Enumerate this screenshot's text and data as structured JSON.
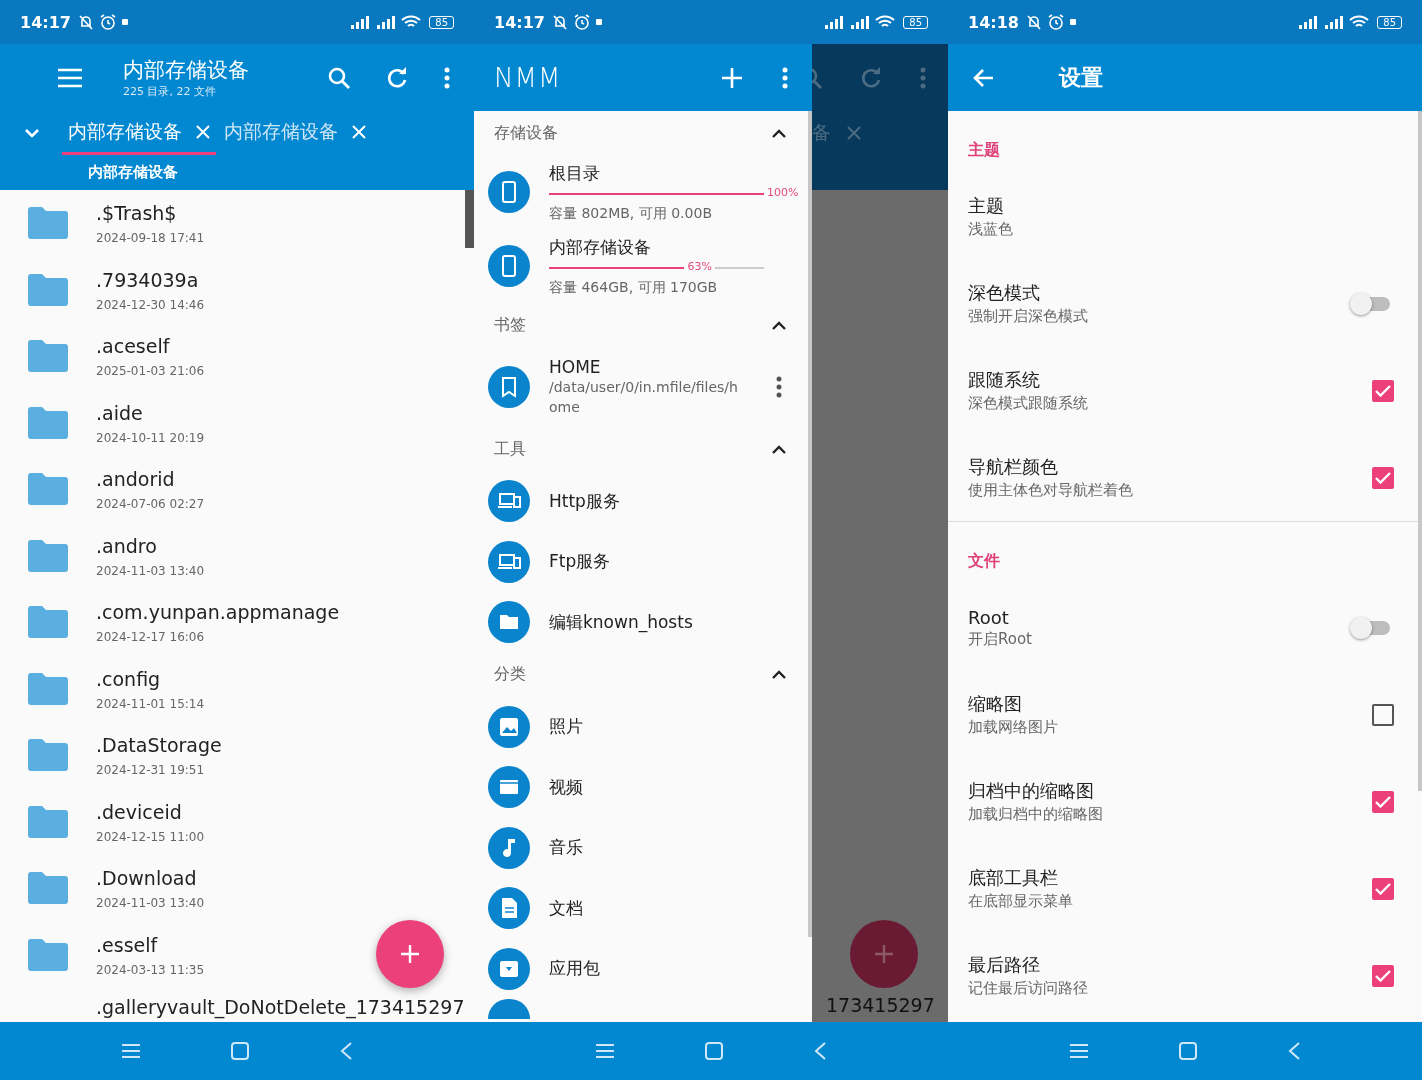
{
  "file_manager": {
    "status_bar": {
      "time": "14:17",
      "battery": "85"
    },
    "title": "内部存储设备",
    "subtitle": "225 目录, 22 文件",
    "tabs": [
      {
        "label": "内部存储设备",
        "selected": true
      },
      {
        "label": "内部存储设备",
        "selected": false
      }
    ],
    "path": "内部存储设备",
    "files": [
      {
        "name": ".$Trash$",
        "date": "2024-09-18 17:41"
      },
      {
        "name": ".7934039a",
        "date": "2024-12-30 14:46"
      },
      {
        "name": ".aceself",
        "date": "2025-01-03 21:06"
      },
      {
        "name": ".aide",
        "date": "2024-10-11 20:19"
      },
      {
        "name": ".andorid",
        "date": "2024-07-06 02:27"
      },
      {
        "name": ".andro",
        "date": "2024-11-03 13:40"
      },
      {
        "name": ".com.yunpan.appmanage",
        "date": "2024-12-17 16:06"
      },
      {
        "name": ".config",
        "date": "2024-11-01 15:14"
      },
      {
        "name": ".DataStorage",
        "date": "2024-12-31 19:51"
      },
      {
        "name": ".deviceid",
        "date": "2024-12-15 11:00"
      },
      {
        "name": ".Download",
        "date": "2024-11-03 13:40"
      },
      {
        "name": ".esself",
        "date": "2024-03-13 11:35"
      },
      {
        "name": ".galleryvault_DoNotDelete_173415297"
      }
    ]
  },
  "drawer_screen": {
    "status_bar": {
      "time": "14:17",
      "battery": "85"
    },
    "title": "NMM",
    "sections": [
      {
        "title": "存储设备",
        "expanded": true,
        "items": [
          {
            "kind": "storage",
            "name": "根目录",
            "level": 1.0,
            "reading": "100%",
            "detail": "容量 802MB, 可用 0.00B"
          },
          {
            "kind": "storage",
            "name": "内部存储设备",
            "level": 0.63,
            "reading": "63%",
            "detail": "容量 464GB, 可用 170GB"
          }
        ]
      },
      {
        "title": "书签",
        "expanded": true,
        "items": [
          {
            "kind": "bookmark",
            "name": "HOME",
            "detail": "/data/user/0/in.mfile/files/home"
          }
        ]
      },
      {
        "title": "工具",
        "expanded": true,
        "items": [
          {
            "kind": "tool",
            "name": "Http服务"
          },
          {
            "kind": "tool",
            "name": "Ftp服务"
          },
          {
            "kind": "folder",
            "name": "编辑known_hosts"
          }
        ]
      },
      {
        "title": "分类",
        "expanded": true,
        "items": [
          {
            "kind": "image",
            "name": "照片"
          },
          {
            "kind": "video",
            "name": "视频"
          },
          {
            "kind": "music",
            "name": "音乐"
          },
          {
            "kind": "document",
            "name": "文档"
          },
          {
            "kind": "package",
            "name": "应用包"
          }
        ]
      }
    ],
    "behind": {
      "tab_fragment": "备",
      "file_fragment": "173415297"
    }
  },
  "settings_screen": {
    "status_bar": {
      "time": "14:18",
      "battery": "85"
    },
    "title": "设置",
    "sections": [
      {
        "title": "主题",
        "items": [
          {
            "kind": "text",
            "title": "主题",
            "summary": "浅蓝色"
          },
          {
            "kind": "switch",
            "title": "深色模式",
            "summary": "强制开启深色模式",
            "checked": false
          },
          {
            "kind": "checkbox",
            "title": "跟随系统",
            "summary": "深色模式跟随系统",
            "checked": true
          },
          {
            "kind": "checkbox",
            "title": "导航栏颜色",
            "summary": "使用主体色对导航栏着色",
            "checked": true
          }
        ]
      },
      {
        "title": "文件",
        "items": [
          {
            "kind": "switch",
            "title": "Root",
            "summary": "开启Root",
            "checked": false
          },
          {
            "kind": "checkbox",
            "title": "缩略图",
            "summary": "加载网络图片",
            "checked": false
          },
          {
            "kind": "checkbox",
            "title": "归档中的缩略图",
            "summary": "加载归档中的缩略图",
            "checked": true
          },
          {
            "kind": "checkbox",
            "title": "底部工具栏",
            "summary": "在底部显示菜单",
            "checked": true
          },
          {
            "kind": "checkbox",
            "title": "最后路径",
            "summary": "记住最后访问路径",
            "checked": true
          }
        ]
      }
    ]
  }
}
